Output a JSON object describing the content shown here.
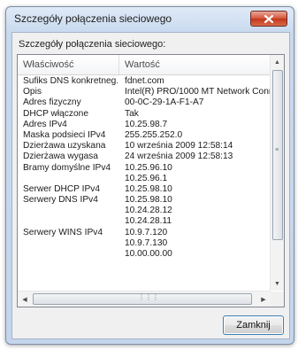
{
  "window": {
    "title": "Szczegóły połączenia sieciowego"
  },
  "dialog": {
    "caption": "Szczegóły połączenia sieciowego:",
    "close_button_label": "Zamknij"
  },
  "table": {
    "columns": [
      "Właściwość",
      "Wartość"
    ],
    "rows": [
      {
        "prop": "Sufiks DNS konkretneg...",
        "value": "fdnet.com"
      },
      {
        "prop": "Opis",
        "value": "Intel(R) PRO/1000 MT Network Conn"
      },
      {
        "prop": "Adres fizyczny",
        "value": "00-0C-29-1A-F1-A7"
      },
      {
        "prop": "DHCP włączone",
        "value": "Tak"
      },
      {
        "prop": "Adres IPv4",
        "value": "10.25.98.7"
      },
      {
        "prop": "Maska podsieci IPv4",
        "value": "255.255.252.0"
      },
      {
        "prop": "Dzierżawa uzyskana",
        "value": "10 września 2009 12:58:14"
      },
      {
        "prop": "Dzierżawa wygasa",
        "value": "24 września 2009 12:58:13"
      },
      {
        "prop": "Bramy domyślne IPv4",
        "value": "10.25.96.10"
      },
      {
        "prop": "",
        "value": "10.25.96.1"
      },
      {
        "prop": "Serwer DHCP IPv4",
        "value": "10.25.98.10"
      },
      {
        "prop": "Serwery DNS IPv4",
        "value": "10.25.98.10"
      },
      {
        "prop": "",
        "value": "10.24.28.12"
      },
      {
        "prop": "",
        "value": "10.24.28.11"
      },
      {
        "prop": "Serwery WINS IPv4",
        "value": "10.9.7.120"
      },
      {
        "prop": "",
        "value": "10.9.7.130"
      },
      {
        "prop": "",
        "value": "10.00.00.00"
      }
    ]
  },
  "icons": {
    "close": "close-icon",
    "scroll_up": "arrow-up-icon",
    "scroll_down": "arrow-down-icon",
    "scroll_left": "arrow-left-icon",
    "scroll_right": "arrow-right-icon"
  },
  "colors": {
    "close_button": "#c2371b",
    "default_button_border": "#3c7fb1",
    "title_bar": "#cddcf0"
  }
}
